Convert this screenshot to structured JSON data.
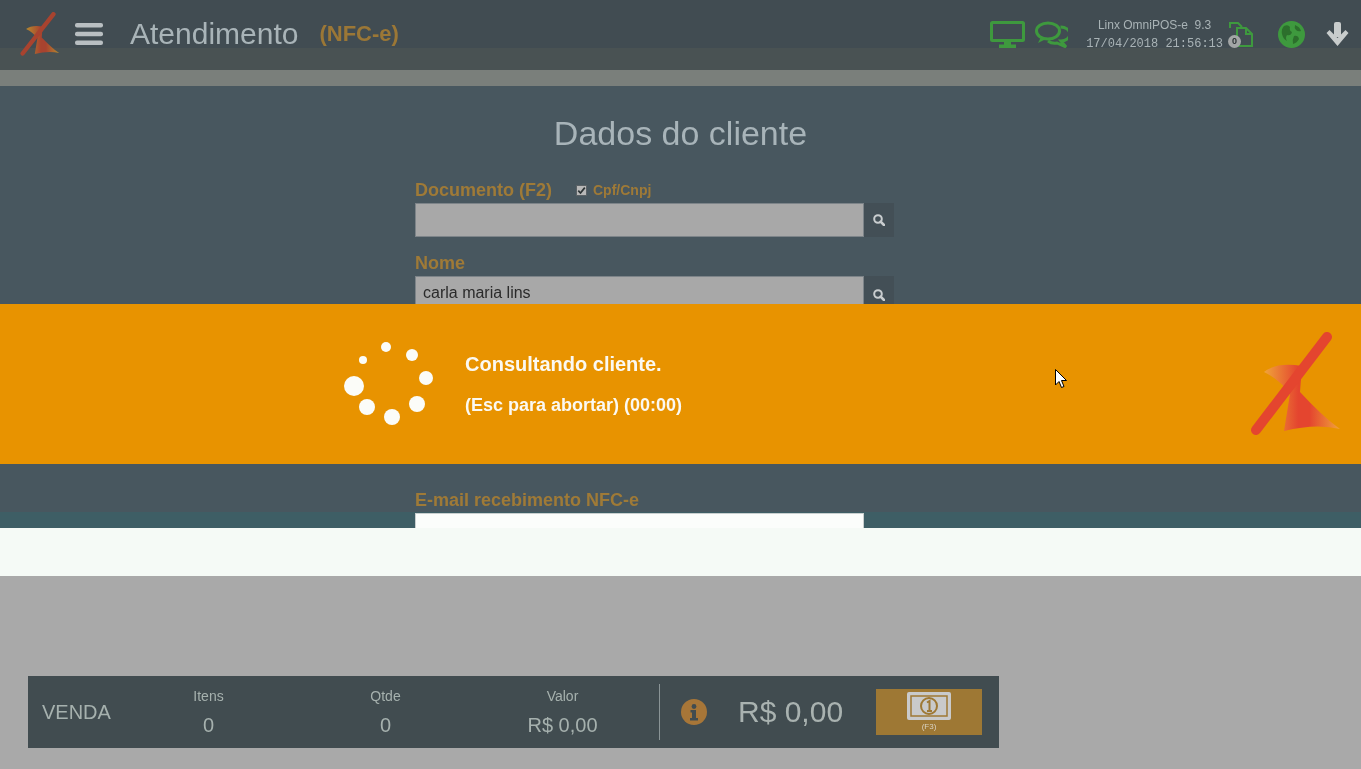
{
  "header": {
    "title": "Atendimento",
    "mode": "(NFC-e)",
    "app_version": "Linx OmniPOS-e  9.3",
    "datetime": "17/04/2018 21:56:13",
    "documents_badge": "0"
  },
  "dialog": {
    "title": "Dados do cliente",
    "fields": [
      {
        "kind": "search",
        "label": "Documento (F2)",
        "option": {
          "label": "Cpf/Cnpj",
          "checked": true
        }
      },
      {
        "kind": "search",
        "label": "Nome",
        "value": "carla maria lins"
      },
      {
        "kind": "text",
        "label": "E-mail recebimento NFC-e"
      }
    ]
  },
  "loading": {
    "message": "Consultando cliente.",
    "hint": "(Esc para abortar) (00:00)"
  },
  "sale": {
    "title": "VENDA",
    "columns": [
      {
        "label": "Itens",
        "value": "0"
      },
      {
        "label": "Qtde",
        "value": "0"
      },
      {
        "label": "Valor",
        "value": "R$ 0,00"
      }
    ],
    "total": "R$ 0,00",
    "pay_button": {
      "shortcut": "(F3)"
    }
  }
}
